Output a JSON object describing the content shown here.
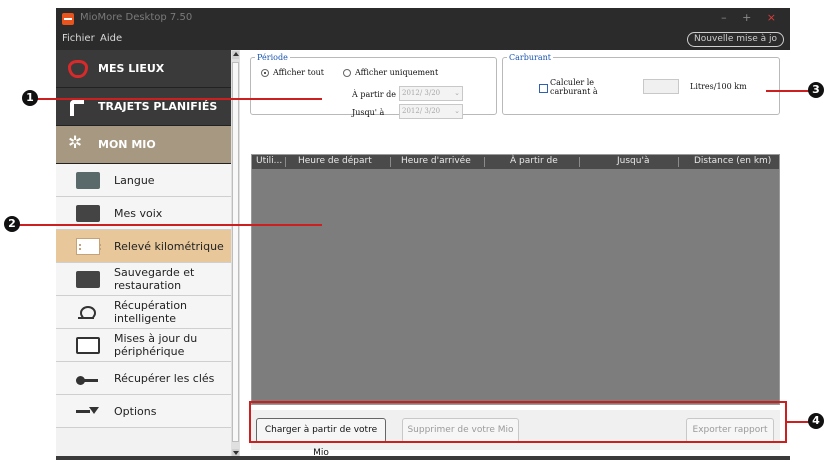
{
  "window": {
    "title": "MioMore Desktop 7.50",
    "controls": [
      "–",
      "+",
      "×"
    ]
  },
  "menubar": {
    "items": [
      "Fichier",
      "Aide"
    ],
    "update_button": "Nouvelle mise à jo"
  },
  "sidebar": {
    "headers": [
      {
        "label": "MES LIEUX",
        "icon": "heart-outline-icon"
      },
      {
        "label": "TRAJETS PLANIFIÉS",
        "icon": "route-icon"
      },
      {
        "label": "MON MIO",
        "icon": "gear-icon"
      }
    ],
    "items": [
      {
        "label": "Langue",
        "icon": "language-icon"
      },
      {
        "label": "Mes voix",
        "icon": "voices-icon"
      },
      {
        "label": "Relevé kilométrique",
        "icon": "odometer-icon",
        "active": true
      },
      {
        "label": "Sauvegarde et restauration",
        "icon": "backup-icon"
      },
      {
        "label": "Récupération intelligente",
        "icon": "smart-recovery-icon"
      },
      {
        "label": "Mises à jour du périphérique",
        "icon": "device-update-icon"
      },
      {
        "label": "Récupérer les clés",
        "icon": "key-icon"
      },
      {
        "label": "Options",
        "icon": "options-arrow-icon"
      }
    ]
  },
  "periode": {
    "legend": "Période",
    "show_all": "Afficher tout",
    "show_only": "Afficher uniquement",
    "from_label": "À partir de",
    "from_value": "2012/ 3/20",
    "to_label": "Jusqu' à",
    "to_value": "2012/ 3/20",
    "selected": "show_all"
  },
  "carburant": {
    "legend": "Carburant",
    "calc_label": "Calculer le carburant à",
    "unit": "Litres/100 km"
  },
  "table": {
    "columns": [
      "Utili...",
      "Heure de départ",
      "Heure d'arrivée",
      "À partir de",
      "Jusqu'à",
      "Distance (en km)"
    ]
  },
  "buttons": {
    "load": "Charger à partir de votre Mio",
    "delete": "Supprimer de votre Mio",
    "export": "Exporter rapport"
  },
  "annotations": [
    "1",
    "2",
    "3",
    "4"
  ],
  "colors": {
    "accent": "#cc1f1f",
    "active_item": "#e8c89b",
    "mon_mio_header": "#a79981"
  }
}
